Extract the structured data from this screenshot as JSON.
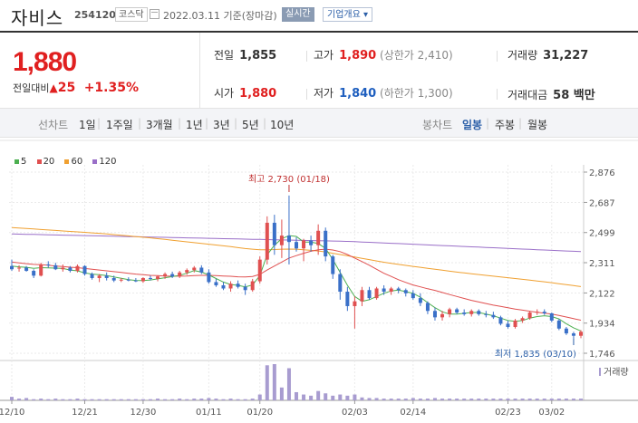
{
  "header": {
    "name": "자비스",
    "code": "254120",
    "market": "코스닥",
    "date": "2022.03.11 기준(장마감)",
    "realtime": "실시간",
    "company_info": "기업개요"
  },
  "quote": {
    "price": "1,880",
    "change_label": "전일대비",
    "change_arrow": "▲",
    "change": "25",
    "change_pct": "+1.35%",
    "prev_close_label": "전일",
    "prev_close": "1,855",
    "high_label": "고가",
    "high": "1,890",
    "upper_limit": "(상한가 2,410)",
    "volume_label": "거래량",
    "volume": "31,227",
    "open_label": "시가",
    "open": "1,880",
    "low_label": "저가",
    "low": "1,840",
    "lower_limit": "(하한가 1,300)",
    "amount_label": "거래대금",
    "amount": "58 백만"
  },
  "tabs": {
    "line_label": "선차트",
    "periods": [
      "1일",
      "1주일",
      "3개월",
      "1년",
      "3년",
      "5년",
      "10년"
    ],
    "candle_label": "봉차트",
    "candles": [
      "일봉",
      "주봉",
      "월봉"
    ],
    "selected_candle": "일봉"
  },
  "chart_data": {
    "type": "candlestick",
    "legend": [
      {
        "name": "5",
        "color": "#4caf50"
      },
      {
        "name": "20",
        "color": "#e05050"
      },
      {
        "name": "60",
        "color": "#f0a030"
      },
      {
        "name": "120",
        "color": "#9a6fc8"
      }
    ],
    "y_ticks": [
      "2,876",
      "2,687",
      "2,499",
      "2,311",
      "2,122",
      "1,934",
      "1,746"
    ],
    "x_ticks": [
      "12/10",
      "12/21",
      "12/30",
      "01/11",
      "01/20",
      "02/03",
      "02/14",
      "02/23",
      "03/02"
    ],
    "high_annotation": "최고 2,730 (01/18)",
    "low_annotation": "최저 1,835 (03/10)",
    "volume_label": "거래량",
    "colors": {
      "up": "#e05050",
      "down": "#3a70c8",
      "volume": "#a89cd0"
    },
    "candles": [
      [
        2290,
        2330,
        2260,
        2270
      ],
      [
        2275,
        2295,
        2255,
        2280
      ],
      [
        2280,
        2290,
        2255,
        2260
      ],
      [
        2260,
        2270,
        2215,
        2230
      ],
      [
        2230,
        2310,
        2225,
        2300
      ],
      [
        2300,
        2320,
        2280,
        2295
      ],
      [
        2295,
        2310,
        2265,
        2270
      ],
      [
        2270,
        2300,
        2255,
        2280
      ],
      [
        2280,
        2290,
        2250,
        2260
      ],
      [
        2260,
        2300,
        2250,
        2290
      ],
      [
        2290,
        2295,
        2230,
        2240
      ],
      [
        2240,
        2250,
        2205,
        2215
      ],
      [
        2215,
        2240,
        2190,
        2230
      ],
      [
        2230,
        2250,
        2200,
        2215
      ],
      [
        2215,
        2230,
        2190,
        2200
      ],
      [
        2200,
        2215,
        2190,
        2205
      ],
      [
        2205,
        2220,
        2195,
        2200
      ],
      [
        2200,
        2215,
        2190,
        2195
      ],
      [
        2195,
        2220,
        2185,
        2215
      ],
      [
        2215,
        2230,
        2200,
        2210
      ],
      [
        2210,
        2230,
        2195,
        2225
      ],
      [
        2225,
        2250,
        2210,
        2240
      ],
      [
        2240,
        2255,
        2215,
        2225
      ],
      [
        2225,
        2260,
        2215,
        2250
      ],
      [
        2250,
        2275,
        2235,
        2265
      ],
      [
        2265,
        2290,
        2250,
        2280
      ],
      [
        2280,
        2295,
        2240,
        2250
      ],
      [
        2250,
        2270,
        2180,
        2190
      ],
      [
        2190,
        2210,
        2160,
        2170
      ],
      [
        2170,
        2190,
        2140,
        2150
      ],
      [
        2150,
        2195,
        2130,
        2180
      ],
      [
        2180,
        2200,
        2150,
        2160
      ],
      [
        2160,
        2180,
        2110,
        2140
      ],
      [
        2140,
        2210,
        2130,
        2195
      ],
      [
        2195,
        2350,
        2180,
        2330
      ],
      [
        2330,
        2600,
        2300,
        2560
      ],
      [
        2560,
        2610,
        2360,
        2420
      ],
      [
        2420,
        2580,
        2340,
        2480
      ],
      [
        2480,
        2730,
        2300,
        2440
      ],
      [
        2440,
        2470,
        2380,
        2400
      ],
      [
        2400,
        2460,
        2320,
        2450
      ],
      [
        2450,
        2480,
        2380,
        2420
      ],
      [
        2420,
        2550,
        2360,
        2510
      ],
      [
        2510,
        2530,
        2320,
        2350
      ],
      [
        2350,
        2360,
        2210,
        2240
      ],
      [
        2240,
        2270,
        2080,
        2130
      ],
      [
        2130,
        2160,
        2010,
        2040
      ],
      [
        2040,
        2100,
        1900,
        2070
      ],
      [
        2070,
        2160,
        2040,
        2140
      ],
      [
        2140,
        2160,
        2080,
        2090
      ],
      [
        2090,
        2160,
        2080,
        2150
      ],
      [
        2150,
        2170,
        2110,
        2130
      ],
      [
        2130,
        2160,
        2110,
        2150
      ],
      [
        2150,
        2160,
        2120,
        2140
      ],
      [
        2140,
        2150,
        2100,
        2120
      ],
      [
        2120,
        2140,
        2080,
        2090
      ],
      [
        2090,
        2120,
        2040,
        2060
      ],
      [
        2060,
        2070,
        1990,
        2010
      ],
      [
        2010,
        2030,
        1950,
        1970
      ],
      [
        1970,
        2010,
        1950,
        1990
      ],
      [
        1990,
        2030,
        1970,
        2020
      ],
      [
        2020,
        2030,
        1990,
        2000
      ],
      [
        2000,
        2020,
        1980,
        1990
      ],
      [
        1990,
        2020,
        1975,
        2010
      ],
      [
        2010,
        2020,
        1980,
        1990
      ],
      [
        1990,
        2010,
        1970,
        1985
      ],
      [
        1985,
        2005,
        1960,
        1970
      ],
      [
        1970,
        1980,
        1920,
        1930
      ],
      [
        1930,
        1950,
        1900,
        1910
      ],
      [
        1910,
        1960,
        1900,
        1950
      ],
      [
        1950,
        1975,
        1935,
        1965
      ],
      [
        1965,
        2010,
        1955,
        2000
      ],
      [
        2000,
        2020,
        1985,
        2005
      ],
      [
        2005,
        2020,
        1985,
        1995
      ],
      [
        1995,
        2000,
        1940,
        1950
      ],
      [
        1950,
        1960,
        1890,
        1900
      ],
      [
        1900,
        1910,
        1860,
        1870
      ],
      [
        1870,
        1880,
        1835,
        1855
      ],
      [
        1855,
        1890,
        1840,
        1880
      ]
    ],
    "volume": [
      6,
      3,
      4,
      2,
      3,
      2,
      3,
      2,
      2,
      3,
      2,
      2,
      2,
      2,
      2,
      2,
      2,
      2,
      2,
      2,
      3,
      2,
      2,
      3,
      2,
      3,
      3,
      4,
      3,
      2,
      3,
      2,
      2,
      3,
      10,
      60,
      62,
      22,
      55,
      14,
      10,
      8,
      16,
      12,
      8,
      10,
      8,
      10,
      5,
      4,
      4,
      3,
      3,
      3,
      3,
      4,
      3,
      3,
      4,
      3,
      3,
      3,
      3,
      3,
      3,
      3,
      3,
      3,
      3,
      3,
      3,
      3,
      3,
      3,
      3,
      3,
      3,
      3,
      3
    ],
    "ma5": [
      2290,
      2285,
      2282,
      2276,
      2280,
      2278,
      2277,
      2275,
      2265,
      2260,
      2248,
      2240,
      2236,
      2230,
      2222,
      2214,
      2205,
      2200,
      2199,
      2203,
      2210,
      2217,
      2224,
      2232,
      2245,
      2262,
      2252,
      2235,
      2212,
      2190,
      2175,
      2170,
      2160,
      2172,
      2230,
      2360,
      2420,
      2460,
      2480,
      2475,
      2440,
      2440,
      2430,
      2400,
      2330,
      2250,
      2170,
      2100,
      2070,
      2080,
      2100,
      2120,
      2135,
      2140,
      2130,
      2120,
      2095,
      2062,
      2030,
      2005,
      1990,
      1990,
      1995,
      2000,
      2000,
      1990,
      1980,
      1965,
      1950,
      1945,
      1950,
      1965,
      1975,
      1980,
      1975,
      1960,
      1930,
      1905,
      1885
    ],
    "ma20": [
      2315,
      2310,
      2305,
      2300,
      2298,
      2295,
      2290,
      2287,
      2283,
      2280,
      2275,
      2270,
      2265,
      2260,
      2255,
      2250,
      2245,
      2240,
      2236,
      2232,
      2230,
      2228,
      2227,
      2227,
      2228,
      2230,
      2232,
      2232,
      2230,
      2228,
      2226,
      2223,
      2222,
      2225,
      2238,
      2265,
      2290,
      2315,
      2340,
      2355,
      2370,
      2382,
      2392,
      2395,
      2390,
      2380,
      2362,
      2340,
      2318,
      2295,
      2270,
      2245,
      2225,
      2205,
      2188,
      2172,
      2160,
      2148,
      2138,
      2125,
      2112,
      2100,
      2088,
      2076,
      2066,
      2056,
      2046,
      2038,
      2030,
      2022,
      2015,
      2008,
      2002,
      1996,
      1990,
      1982,
      1972,
      1962,
      1952
    ],
    "ma60": [
      2530,
      2527,
      2524,
      2521,
      2518,
      2515,
      2512,
      2509,
      2506,
      2503,
      2500,
      2497,
      2494,
      2490,
      2486,
      2482,
      2478,
      2474,
      2470,
      2466,
      2461,
      2456,
      2451,
      2446,
      2441,
      2436,
      2431,
      2426,
      2421,
      2416,
      2411,
      2405,
      2399,
      2395,
      2392,
      2392,
      2393,
      2395,
      2396,
      2395,
      2392,
      2388,
      2384,
      2378,
      2370,
      2362,
      2354,
      2346,
      2338,
      2330,
      2322,
      2314,
      2307,
      2300,
      2294,
      2288,
      2282,
      2276,
      2270,
      2264,
      2258,
      2252,
      2247,
      2242,
      2237,
      2232,
      2227,
      2222,
      2217,
      2212,
      2207,
      2202,
      2197,
      2192,
      2186,
      2180,
      2174,
      2168,
      2162
    ],
    "ma120": [
      2490,
      2489,
      2488,
      2487,
      2486,
      2485,
      2484,
      2483,
      2482,
      2481,
      2480,
      2479,
      2478,
      2477,
      2476,
      2475,
      2474,
      2473,
      2472,
      2471,
      2470,
      2469,
      2468,
      2467,
      2466,
      2465,
      2464,
      2463,
      2462,
      2461,
      2460,
      2459,
      2458,
      2457,
      2456,
      2455,
      2454,
      2453,
      2452,
      2451,
      2450,
      2449,
      2448,
      2447,
      2446,
      2445,
      2444,
      2442,
      2440,
      2438,
      2436,
      2434,
      2432,
      2430,
      2428,
      2426,
      2424,
      2422,
      2420,
      2418,
      2416,
      2414,
      2412,
      2410,
      2408,
      2406,
      2404,
      2402,
      2400,
      2398,
      2396,
      2394,
      2392,
      2390,
      2388,
      2386,
      2384,
      2382,
      2380
    ]
  }
}
